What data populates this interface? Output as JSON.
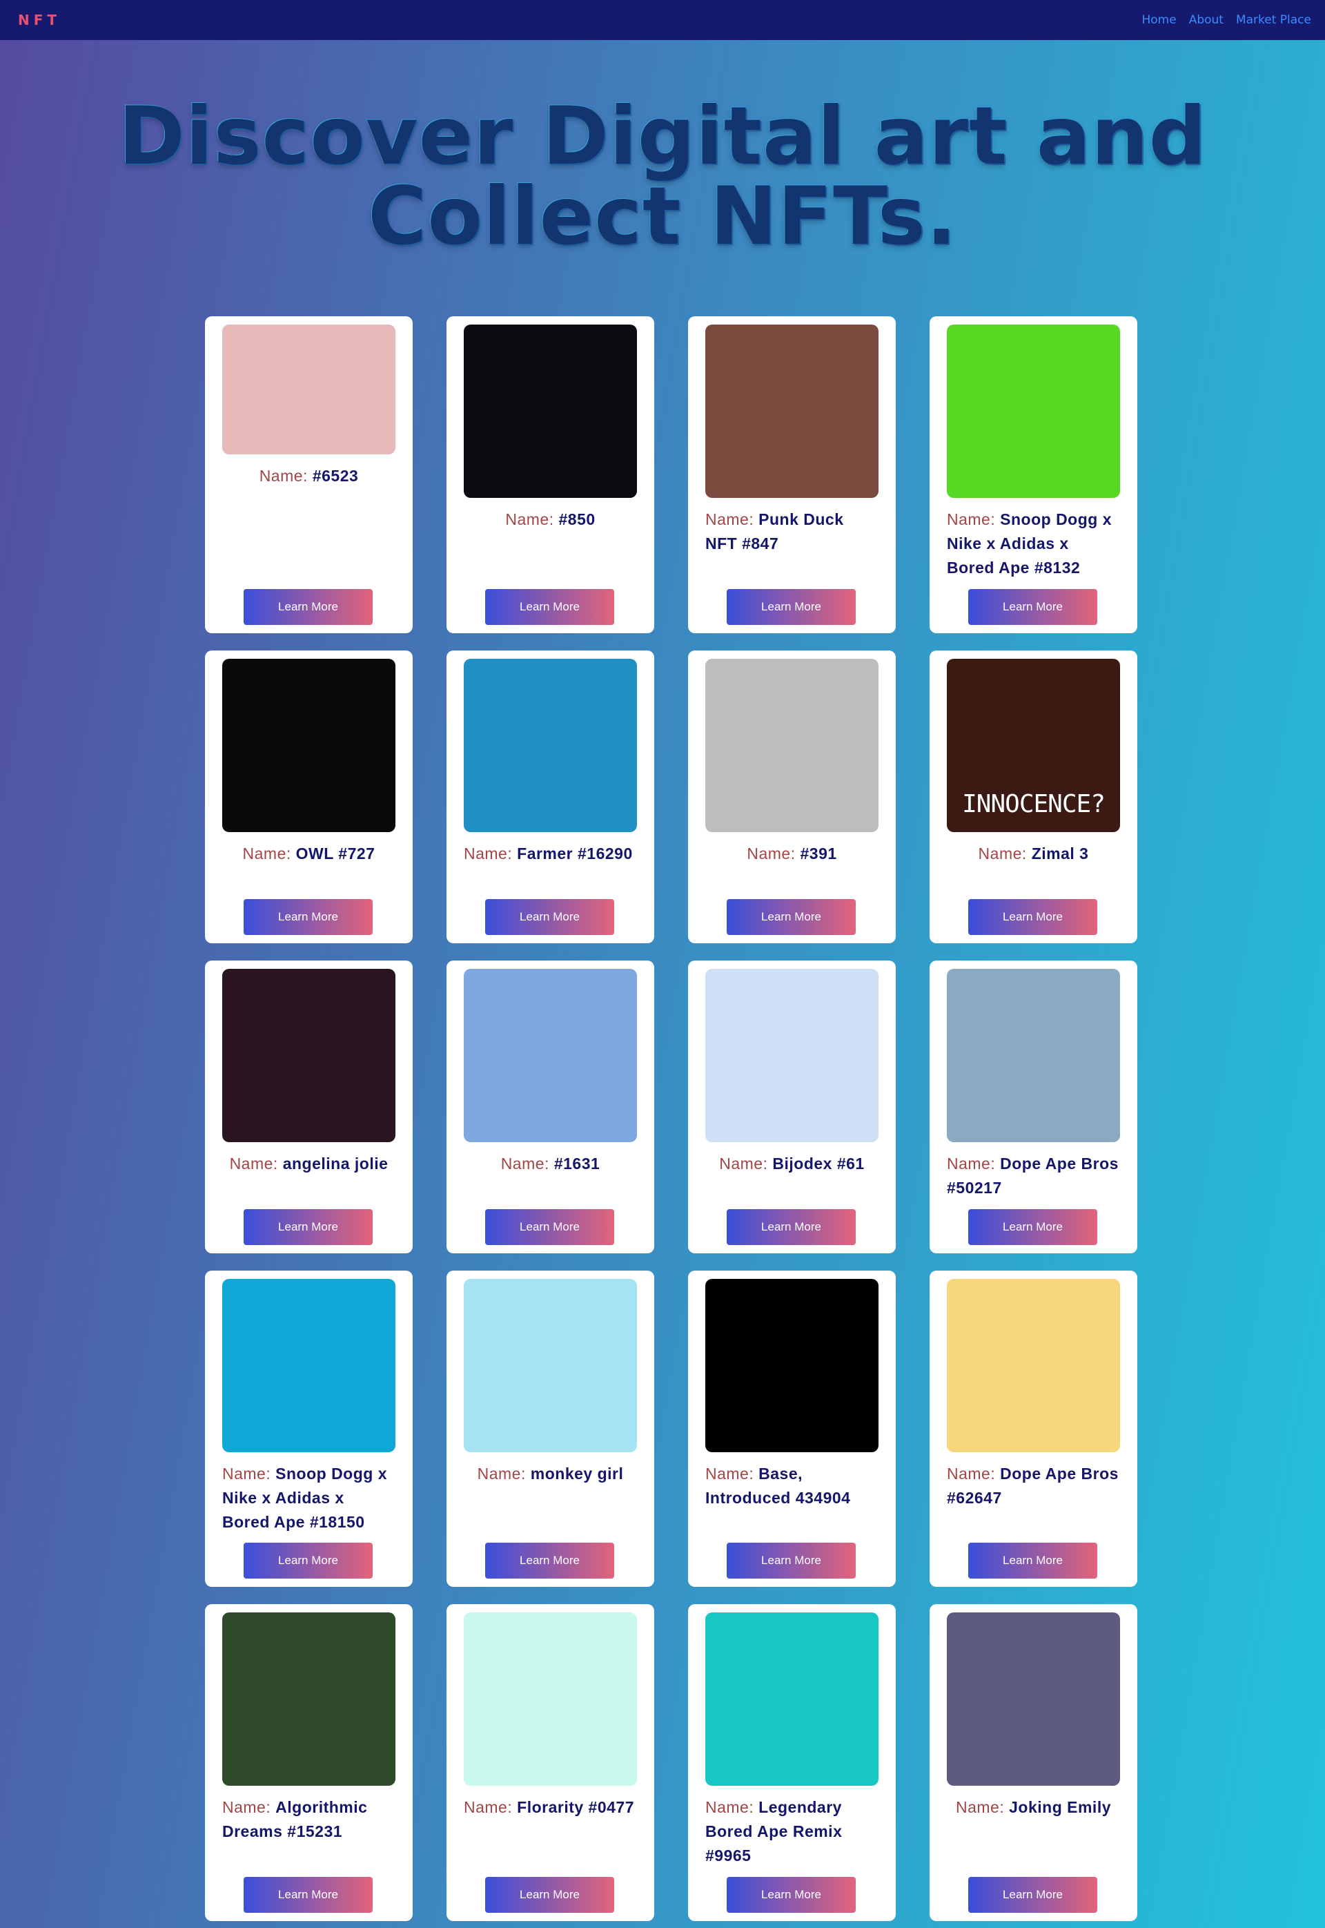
{
  "nav": {
    "brand": "NFT",
    "links": [
      "Home",
      "About",
      "Market Place"
    ]
  },
  "hero": {
    "title": "Discover Digital art and Collect NFTs."
  },
  "cards": [
    {
      "label": "Name:",
      "name": "#6523",
      "button": "Learn More",
      "art_bg": "#e6b8b8",
      "art": "ape-explorer-icon"
    },
    {
      "label": "Name:",
      "name": "#850",
      "button": "Learn More",
      "art_bg": "#0b0b12",
      "art": "neon-cubes-icon"
    },
    {
      "label": "Name:",
      "name": "Punk Duck NFT #847",
      "button": "Learn More",
      "art_bg": "#7a4a3e",
      "art": "pixel-punk-icon"
    },
    {
      "label": "Name:",
      "name": "Snoop Dogg x Nike x Adidas x Bored Ape #8132",
      "button": "Learn More",
      "art_bg": "#58d822",
      "art": "bored-ape-icon"
    },
    {
      "label": "Name:",
      "name": "OWL #727",
      "button": "Learn More",
      "art_bg": "#0a0a0a",
      "art": "ascii-owl-icon"
    },
    {
      "label": "Name:",
      "name": "Farmer #16290",
      "button": "Learn More",
      "art_bg": "#1f8fc4",
      "art": "farmer-character-icon"
    },
    {
      "label": "Name:",
      "name": "#391",
      "button": "Learn More",
      "art_bg": "#bdbdbd",
      "art": "potato-icon"
    },
    {
      "label": "Name:",
      "name": "Zimal 3",
      "button": "Learn More",
      "art_bg": "#3a1a12",
      "art": "baby-portrait-icon",
      "art_text": "INNOCENCE?"
    },
    {
      "label": "Name:",
      "name": "angelina jolie",
      "button": "Learn More",
      "art_bg": "#2a1420",
      "art": "warrior-woman-icon"
    },
    {
      "label": "Name:",
      "name": "#1631",
      "button": "Learn More",
      "art_bg": "#7fa7e0",
      "art": "ape-banana-icon"
    },
    {
      "label": "Name:",
      "name": "Bijodex #61",
      "button": "Learn More",
      "art_bg": "#cfe0f6",
      "art": "anime-girl-icon"
    },
    {
      "label": "Name:",
      "name": "Dope Ape Bros #50217",
      "button": "Learn More",
      "art_bg": "#8aa9c2",
      "art": "camo-ape-icon"
    },
    {
      "label": "Name:",
      "name": "Snoop Dogg x Nike x Adidas x Bored Ape #18150",
      "button": "Learn More",
      "art_bg": "#10a6d6",
      "art": "halo-ape-icon"
    },
    {
      "label": "Name:",
      "name": "monkey girl",
      "button": "Learn More",
      "art_bg": "#a5e3f2",
      "art": "monkey-girl-icon"
    },
    {
      "label": "Name:",
      "name": "Base, Introduced 434904",
      "button": "Learn More",
      "art_bg": "#000000",
      "art": "dot-grid-icon"
    },
    {
      "label": "Name:",
      "name": "Dope Ape Bros #62647",
      "button": "Learn More",
      "art_bg": "#f7d77c",
      "art": "drip-ape-icon"
    },
    {
      "label": "Name:",
      "name": "Algorithmic Dreams #15231",
      "button": "Learn More",
      "art_bg": "#2e4a2a",
      "art": "villa-landscape-icon"
    },
    {
      "label": "Name:",
      "name": "Florarity #0477",
      "button": "Learn More",
      "art_bg": "#c9f8ec",
      "art": "potted-plant-icon"
    },
    {
      "label": "Name:",
      "name": "Legendary Bored Ape Remix #9965",
      "button": "Learn More",
      "art_bg": "#16c7c4",
      "art": "gold-tooth-ape-icon"
    },
    {
      "label": "Name:",
      "name": "Joking Emily",
      "button": "Learn More",
      "art_bg": "#5c5a7e",
      "art": "ghost-girl-icon"
    }
  ]
}
